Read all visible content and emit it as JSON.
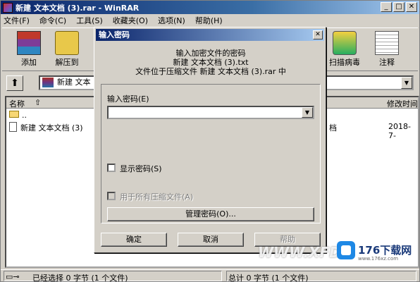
{
  "window": {
    "title": "新建 文本文档 (3).rar - WinRAR",
    "min": "_",
    "max": "□",
    "close": "✕"
  },
  "menu": [
    "文件(F)",
    "命令(C)",
    "工具(S)",
    "收藏夹(O)",
    "选项(N)",
    "帮助(H)"
  ],
  "toolbar": {
    "add": "添加",
    "extract": "解压到",
    "scan": "扫描病毒",
    "comment": "注释"
  },
  "address": {
    "path": "新建 文本"
  },
  "columns": {
    "name": "名称",
    "modified": "修改时间"
  },
  "files": [
    {
      "name": "..",
      "type": "",
      "date": ""
    },
    {
      "name": "新建 文本文档 (3)",
      "type": "档",
      "date": "2018-7-"
    }
  ],
  "status": {
    "left": "已经选择 0 字节 (1 个文件)",
    "right": "总计 0 字节 (1 个文件)"
  },
  "dialog": {
    "title": "输入密码",
    "info_line1": "输入加密文件的密码",
    "info_line2": "新建 文本文档 (3).txt",
    "info_line3": "文件位于压缩文件 新建 文本文档 (3).rar 中",
    "password_label": "输入密码(E)",
    "password_value": "",
    "show_password": "显示密码(S)",
    "use_for_all": "用于所有压缩文件(A)",
    "manage": "管理密码(O)...",
    "ok": "确定",
    "cancel": "取消",
    "help": "帮助"
  },
  "watermark": {
    "www": "WWW.XFD",
    "brand": "176下载网",
    "sub": "www.176xz.com"
  }
}
